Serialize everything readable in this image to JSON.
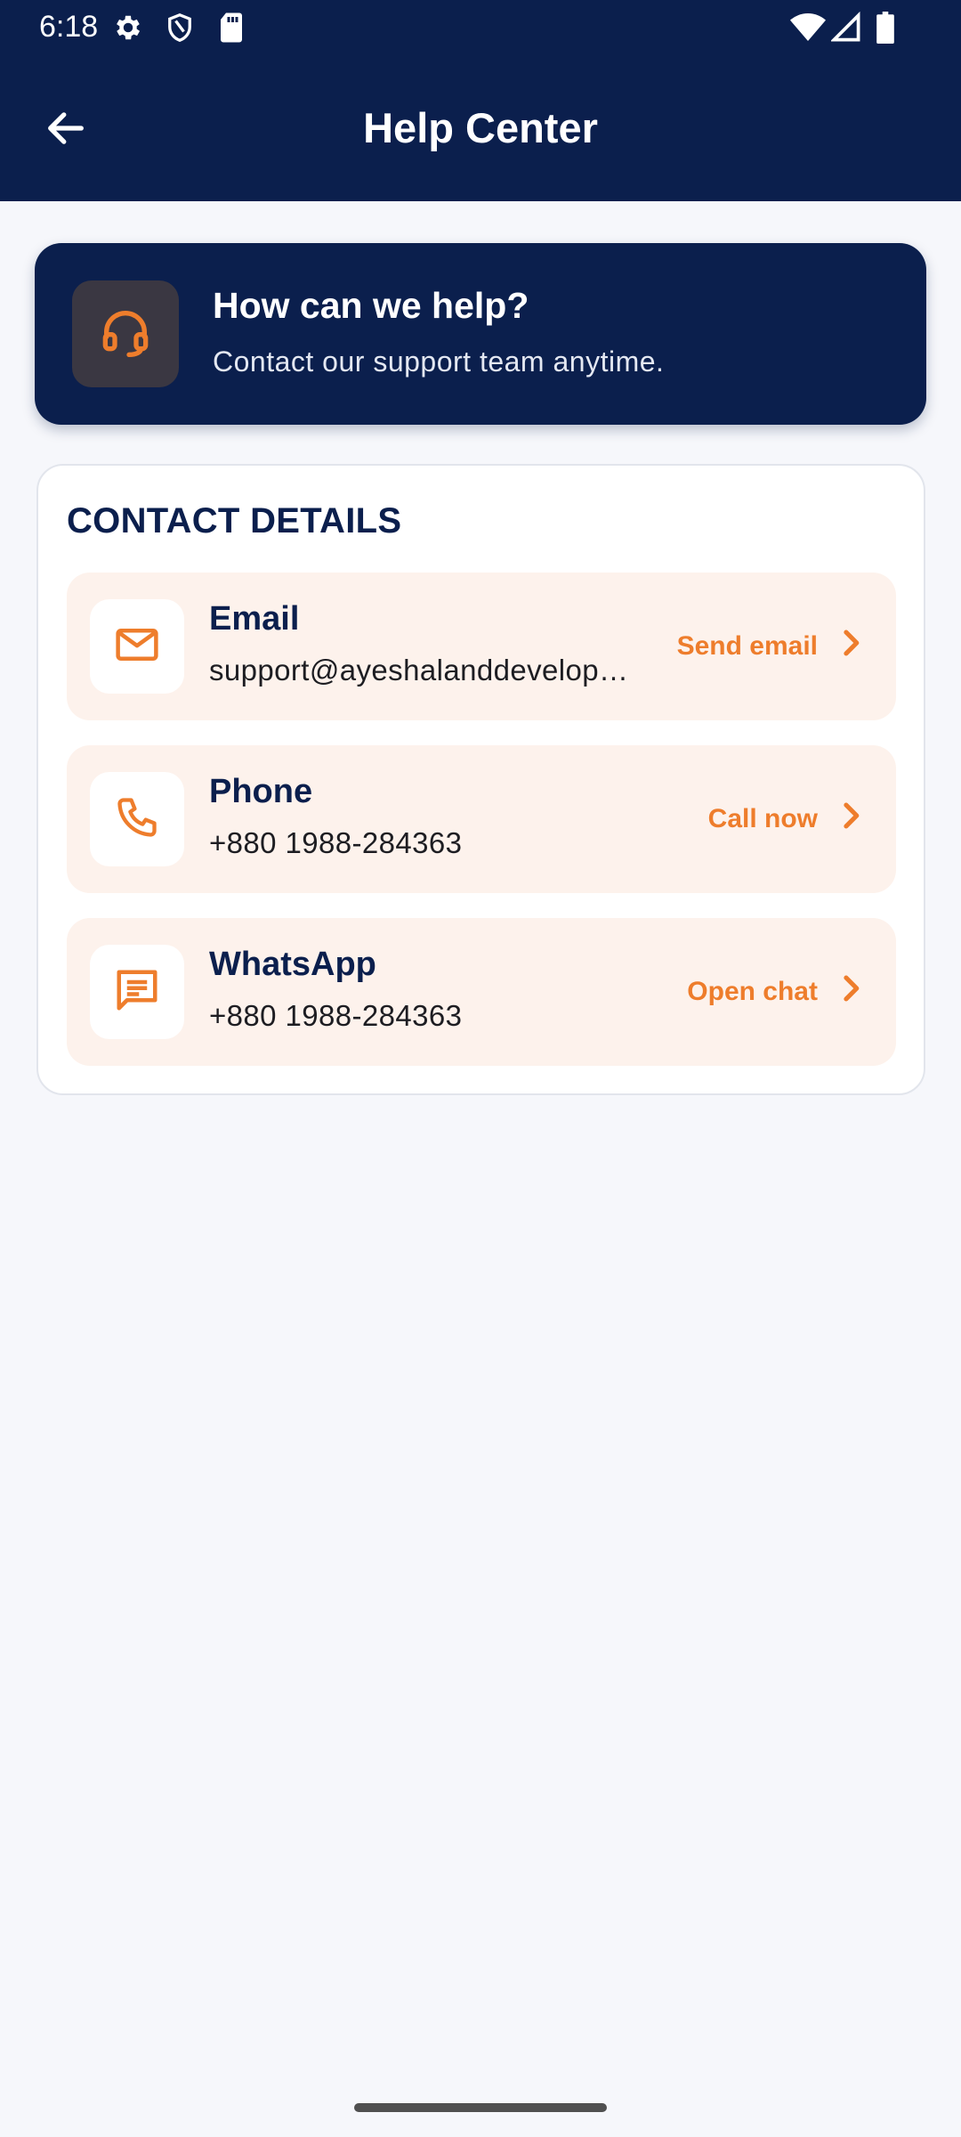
{
  "status_bar": {
    "time": "6:18",
    "icons": [
      "gear-icon",
      "shield-icon",
      "sd-card-icon",
      "wifi-icon",
      "signal-icon",
      "battery-icon"
    ]
  },
  "app_bar": {
    "title": "Help Center",
    "back_icon": "arrow-left-icon"
  },
  "hero": {
    "title": "How can we help?",
    "subtitle": "Contact our support team anytime.",
    "icon": "headset-icon"
  },
  "contact_details": {
    "title": "CONTACT DETAILS",
    "items": [
      {
        "label": "Email",
        "value": "support@ayeshalanddevelop…",
        "action": "Send email",
        "icon": "mail-icon"
      },
      {
        "label": "Phone",
        "value": "+880 1988-284363",
        "action": "Call now",
        "icon": "phone-icon"
      },
      {
        "label": "WhatsApp",
        "value": "+880 1988-284363",
        "action": "Open chat",
        "icon": "chat-icon"
      }
    ]
  },
  "colors": {
    "primary": "#0b1f4d",
    "accent": "#ee7d2c",
    "row_background": "#fdf2ec",
    "page_background": "#f6f7fb"
  }
}
